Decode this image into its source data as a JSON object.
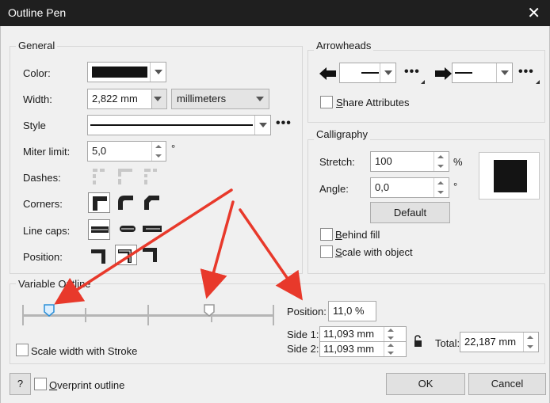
{
  "window": {
    "title": "Outline Pen",
    "close_glyph": "✕"
  },
  "general": {
    "title": "General",
    "color_label": "Color:",
    "color_value": "#141414",
    "width_label": "Width:",
    "width_value": "2,822 mm",
    "units_value": "millimeters",
    "style_label": "Style",
    "miter_label": "Miter limit:",
    "miter_value": "5,0",
    "miter_unit": "°",
    "dashes_label": "Dashes:",
    "corners_label": "Corners:",
    "linecaps_label": "Line caps:",
    "position_label": "Position:",
    "more": "•••"
  },
  "arrowheads": {
    "title": "Arrowheads",
    "share_first": "S",
    "share_rest": "hare Attributes",
    "more": "•••"
  },
  "calligraphy": {
    "title": "Calligraphy",
    "stretch_label": "Stretch:",
    "stretch_value": "100",
    "stretch_unit": "%",
    "angle_label": "Angle:",
    "angle_value": "0,0",
    "angle_unit": "°",
    "default_button": "Default",
    "behind_first": "B",
    "behind_rest": "ehind fill",
    "scale_first": "S",
    "scale_rest": "cale with object"
  },
  "variable_outline": {
    "title": "Variable Outline",
    "position_label": "Position:",
    "position_value": "11,0 %",
    "side1_label": "Side 1:",
    "side1_value": "11,093 mm",
    "side2_label": "Side 2:",
    "side2_value": "11,093 mm",
    "total_label": "Total:",
    "total_value": "22,187 mm",
    "scale_with_stroke": "Scale width with Stroke"
  },
  "footer": {
    "help": "?",
    "overprint_first": "O",
    "overprint_rest": "verprint outline",
    "ok": "OK",
    "cancel": "Cancel"
  },
  "colors": {
    "arrow_red": "#e8392b",
    "marker_blue": "#2b8fd8"
  }
}
